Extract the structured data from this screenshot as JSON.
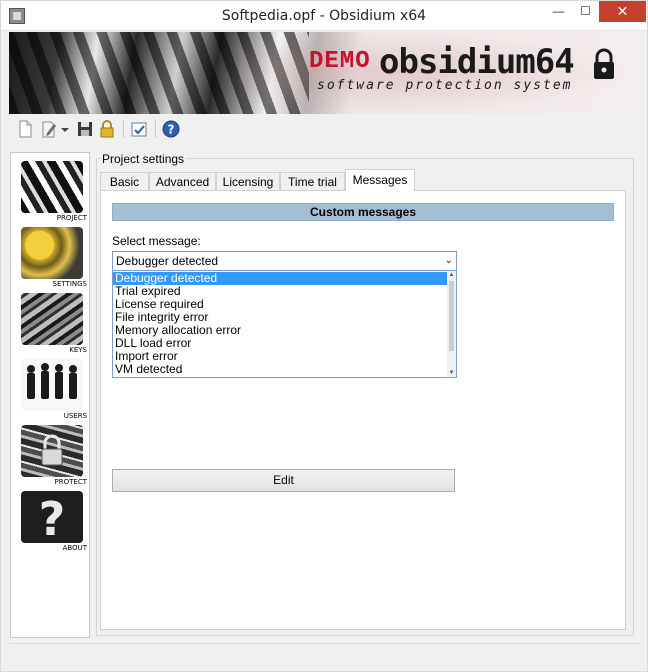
{
  "window": {
    "title": "Softpedia.opf - Obsidium x64",
    "minimize_glyph": "—",
    "maximize_glyph": "☐",
    "close_glyph": "✕"
  },
  "banner": {
    "demo": "DEMO",
    "brand": "obsidium64",
    "tagline": "software protection system"
  },
  "toolbar": {
    "icons": [
      "new-document-icon",
      "edit-document-icon",
      "dropdown-arrow-icon",
      "save-icon",
      "lock-icon",
      "check-icon",
      "help-icon"
    ]
  },
  "nav": {
    "items": [
      {
        "label": "PROJECT",
        "icon": "project-icon"
      },
      {
        "label": "SETTINGS",
        "icon": "settings-icon"
      },
      {
        "label": "KEYS",
        "icon": "keys-icon"
      },
      {
        "label": "USERS",
        "icon": "users-icon"
      },
      {
        "label": "PROTECT",
        "icon": "protect-icon"
      },
      {
        "label": "ABOUT",
        "icon": "about-icon"
      }
    ]
  },
  "main": {
    "group_title": "Project settings",
    "tabs": [
      {
        "label": "Basic"
      },
      {
        "label": "Advanced"
      },
      {
        "label": "Licensing"
      },
      {
        "label": "Time trial"
      },
      {
        "label": "Messages"
      }
    ],
    "active_tab": "Messages",
    "section_header": "Custom messages",
    "select_label": "Select message:",
    "combo_value": "Debugger detected",
    "options": [
      "Debugger detected",
      "Trial expired",
      "License required",
      "File integrity error",
      "Memory allocation error",
      "DLL load error",
      "Import error",
      "VM detected"
    ],
    "edit_button": "Edit"
  },
  "colors": {
    "section_header_bg": "#a6bed4",
    "selection": "#3399ff",
    "close_button": "#c7402f",
    "demo_red": "#c8102e"
  }
}
